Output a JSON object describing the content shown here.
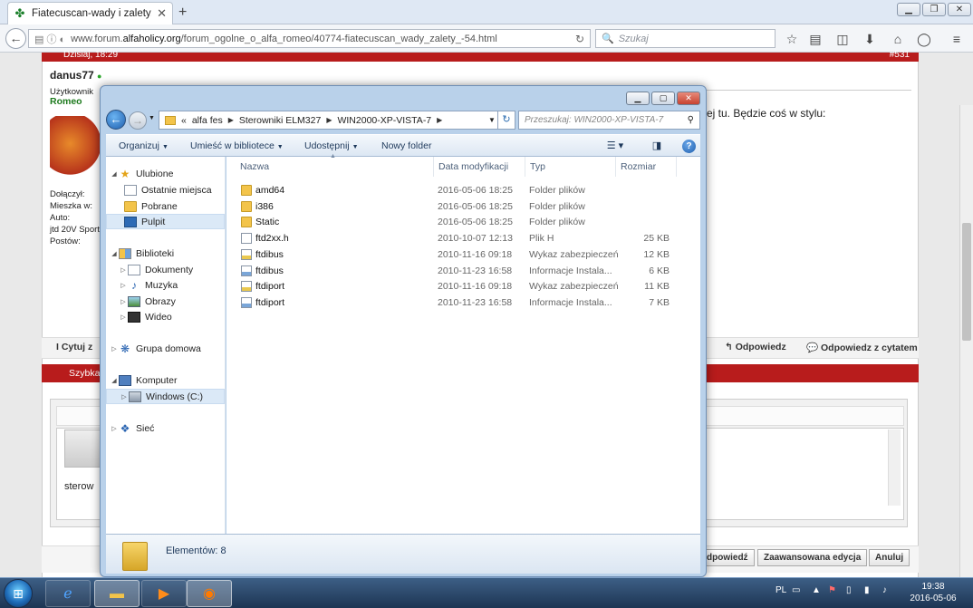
{
  "browser": {
    "tab_title": "Fiatecuscan-wady i zalety. ...",
    "url_prefix": "www.forum.",
    "url_domain": "alfaholicy.org",
    "url_path": "/forum_ogolne_o_alfa_romeo/40774-fiatecuscan_wady_zalety_-54.html",
    "search_placeholder": "Szukaj"
  },
  "forum": {
    "post_date": "Dzisiaj, 18:29",
    "post_number": "#531",
    "author": "danus77",
    "user_title": "Użytkownik",
    "user_rank": "Romeo",
    "joined_label": "Dołączył:",
    "lives_label": "Mieszka w:",
    "car_label": "Auto:",
    "car_value": "jtd 20V Sport",
    "posts_label": "Postów:",
    "post_text_fragment": "ej tu. Będzie coś w stylu:",
    "quote_label": "Cytuj z",
    "reply_label": "Odpowiedz",
    "reply_quote_label": "Odpowiedz z cytatem",
    "quick_reply_label": "Szybka",
    "editor_text": "sterow",
    "reply_button": "dpowiedź",
    "advanced_button": "Zaawansowana edycja",
    "cancel_button": "Anuluj"
  },
  "explorer": {
    "breadcrumb": [
      "«",
      "alfa fes",
      "Sterowniki ELM327",
      "WIN2000-XP-VISTA-7"
    ],
    "search_placeholder": "Przeszukaj: WIN2000-XP-VISTA-7",
    "toolbar": {
      "organize": "Organizuj",
      "include_library": "Umieść w bibliotece",
      "share": "Udostępnij",
      "new_folder": "Nowy folder"
    },
    "nav": {
      "favorites": "Ulubione",
      "recent": "Ostatnie miejsca",
      "downloads": "Pobrane",
      "desktop": "Pulpit",
      "libraries": "Biblioteki",
      "documents": "Dokumenty",
      "music": "Muzyka",
      "pictures": "Obrazy",
      "videos": "Wideo",
      "homegroup": "Grupa domowa",
      "computer": "Komputer",
      "drive_c": "Windows (C:)",
      "network": "Sieć"
    },
    "columns": {
      "name": "Nazwa",
      "date": "Data modyfikacji",
      "type": "Typ",
      "size": "Rozmiar"
    },
    "files": [
      {
        "name": "amd64",
        "date": "2016-05-06 18:25",
        "type": "Folder plików",
        "size": "",
        "icon": "folder-icon"
      },
      {
        "name": "i386",
        "date": "2016-05-06 18:25",
        "type": "Folder plików",
        "size": "",
        "icon": "folder-icon"
      },
      {
        "name": "Static",
        "date": "2016-05-06 18:25",
        "type": "Folder plików",
        "size": "",
        "icon": "folder-icon"
      },
      {
        "name": "ftd2xx.h",
        "date": "2010-10-07 12:13",
        "type": "Plik H",
        "size": "25 KB",
        "icon": "file-icon"
      },
      {
        "name": "ftdibus",
        "date": "2010-11-16 09:18",
        "type": "Wykaz zabezpieczeń",
        "size": "12 KB",
        "icon": "security-catalog-icon"
      },
      {
        "name": "ftdibus",
        "date": "2010-11-23 16:58",
        "type": "Informacje Instala...",
        "size": "6 KB",
        "icon": "setup-info-icon"
      },
      {
        "name": "ftdiport",
        "date": "2010-11-16 09:18",
        "type": "Wykaz zabezpieczeń",
        "size": "11 KB",
        "icon": "security-catalog-icon"
      },
      {
        "name": "ftdiport",
        "date": "2010-11-23 16:58",
        "type": "Informacje Instala...",
        "size": "7 KB",
        "icon": "setup-info-icon"
      }
    ],
    "status": "Elementów: 8"
  },
  "taskbar": {
    "language": "PL",
    "time": "19:38",
    "date": "2016-05-06"
  },
  "colors": {
    "forum_red": "#b81c1c",
    "explorer_frame": "#b9d1ea",
    "taskbar": "#1d3553"
  }
}
